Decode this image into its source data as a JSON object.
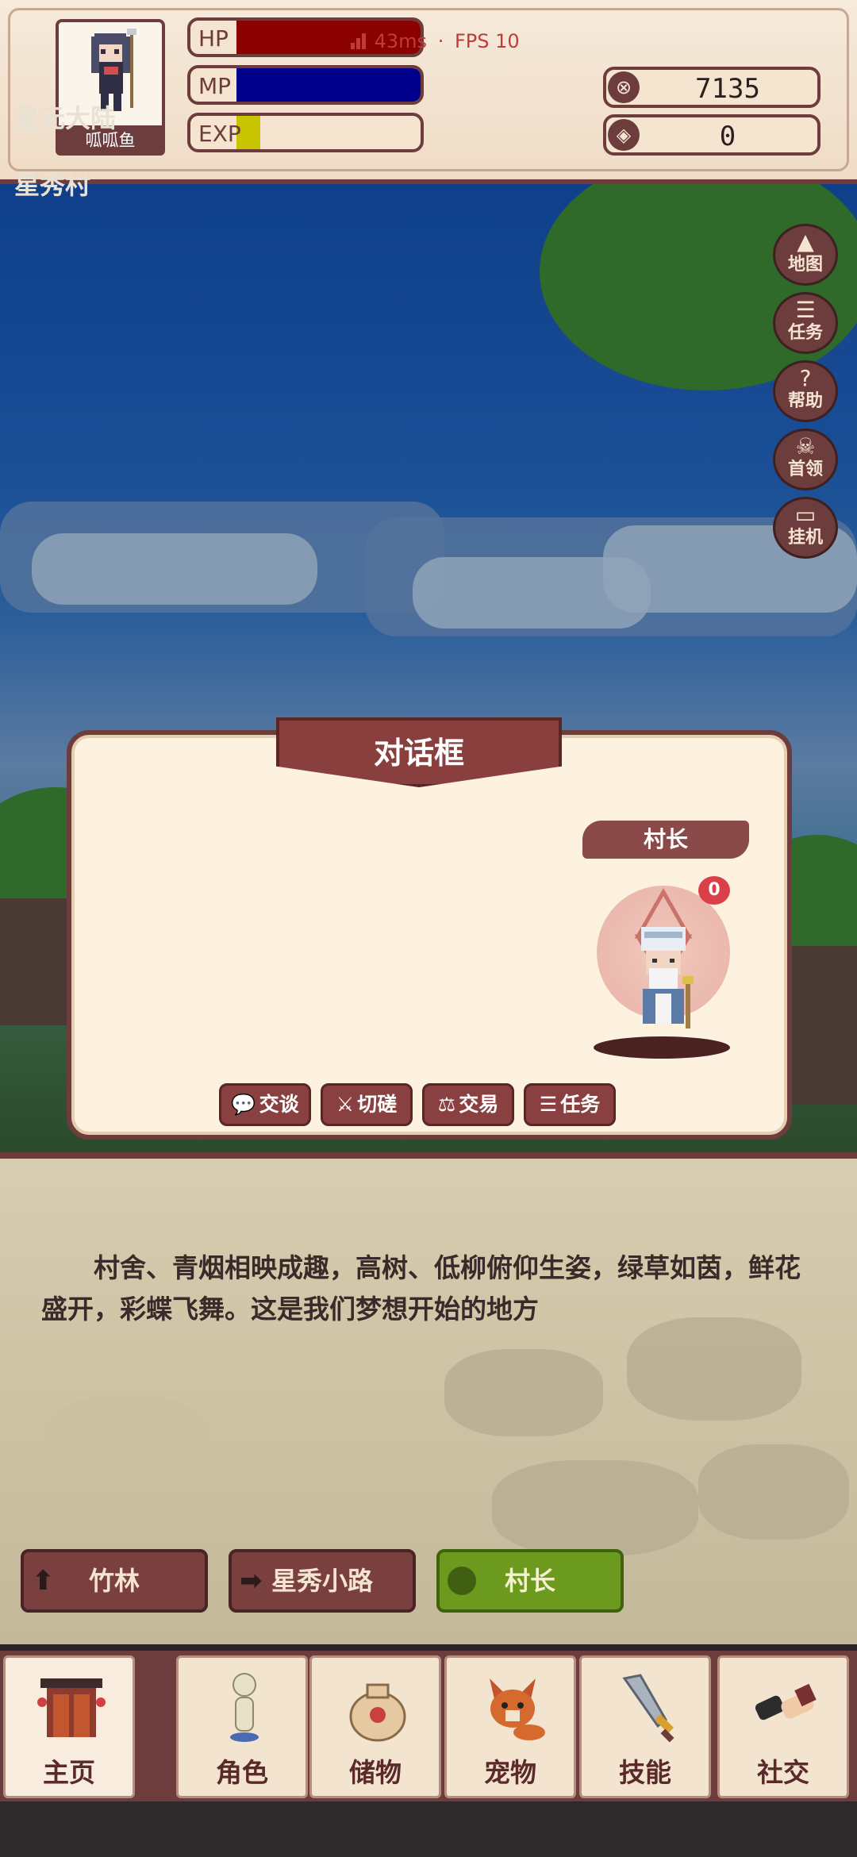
{
  "hud": {
    "player_name": "呱呱鱼",
    "hp_label": "HP",
    "mp_label": "MP",
    "exp_label": "EXP",
    "hp_fraction": 1.0,
    "mp_fraction": 1.0,
    "exp_fraction": 0.13,
    "ping": "43ms",
    "fps": "FPS 10",
    "separator": "·",
    "currency_1": "7135",
    "currency_2": "0",
    "colors": {
      "hp": "#8b0000",
      "mp": "#00008b",
      "exp": "#c8c400"
    }
  },
  "location": {
    "region": "星元大陆",
    "village": "星秀村"
  },
  "side_menu": [
    {
      "icon": "mountain-icon",
      "label": "地图"
    },
    {
      "icon": "task-list-icon",
      "label": "任务"
    },
    {
      "icon": "help-icon",
      "label": "帮助"
    },
    {
      "icon": "boss-skull-icon",
      "label": "首领"
    },
    {
      "icon": "monitor-icon",
      "label": "挂机"
    }
  ],
  "dialog": {
    "title": "对话框",
    "npc_name": "村长",
    "npc_affinity": "0",
    "actions": [
      {
        "icon": "chat-icon",
        "label": "交谈"
      },
      {
        "icon": "sword-icon",
        "label": "切磋"
      },
      {
        "icon": "scales-icon",
        "label": "交易"
      },
      {
        "icon": "task-list-icon",
        "label": "任务"
      }
    ]
  },
  "description": "村舍、青烟相映成趣，高树、低柳俯仰生姿，绿草如茵，鲜花盛开，彩蝶飞舞。这是我们梦想开始的地方",
  "nav": [
    {
      "icon": "arrow-up-icon",
      "label": "竹林"
    },
    {
      "icon": "arrow-right-icon",
      "label": "星秀小路"
    },
    {
      "icon": "person-icon",
      "label": "村长"
    }
  ],
  "tabs": [
    {
      "icon": "gate-icon",
      "label": "主页"
    },
    {
      "icon": "character-icon",
      "label": "角色"
    },
    {
      "icon": "bag-icon",
      "label": "储物"
    },
    {
      "icon": "fox-pet-icon",
      "label": "宠物"
    },
    {
      "icon": "blade-icon",
      "label": "技能"
    },
    {
      "icon": "handshake-icon",
      "label": "社交"
    }
  ]
}
